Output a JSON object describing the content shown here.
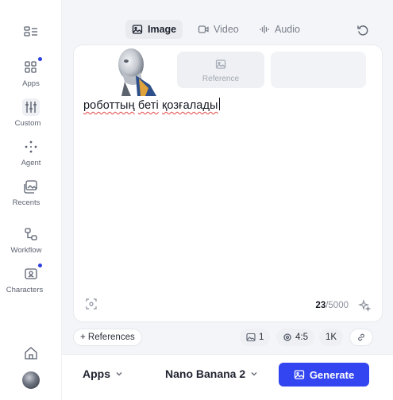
{
  "sidebar": {
    "items": [
      {
        "label": "",
        "icon": "grid-menu-icon"
      },
      {
        "label": "Apps",
        "icon": "apps-icon"
      },
      {
        "label": "Custom",
        "icon": "sliders-icon"
      },
      {
        "label": "Agent",
        "icon": "sparkle-agent-icon"
      },
      {
        "label": "Recents",
        "icon": "image-stack-icon"
      },
      {
        "label": "Workflow",
        "icon": "workflow-icon"
      },
      {
        "label": "Characters",
        "icon": "character-icon"
      }
    ],
    "home_icon": "home-icon",
    "avatar": "user-avatar"
  },
  "tabs": [
    {
      "label": "Image",
      "icon": "image-icon",
      "active": true
    },
    {
      "label": "Video",
      "icon": "video-icon",
      "active": false
    },
    {
      "label": "Audio",
      "icon": "audio-wave-icon",
      "active": false
    }
  ],
  "composer": {
    "reference_label": "Reference",
    "prompt_parts": [
      "роботтың",
      "беті",
      "қозғалады"
    ],
    "char_count": "23",
    "char_limit": "/5000"
  },
  "options": {
    "references_label": "+ References",
    "image_count": "1",
    "aspect_ratio": "4:5",
    "resolution": "1K"
  },
  "footer": {
    "apps_label": "Apps",
    "model_label": "Nano Banana 2",
    "generate_label": "Generate"
  },
  "colors": {
    "accent": "#3245f0",
    "notification_dot": "#2d3fe0",
    "spellcheck": "#e24343"
  }
}
